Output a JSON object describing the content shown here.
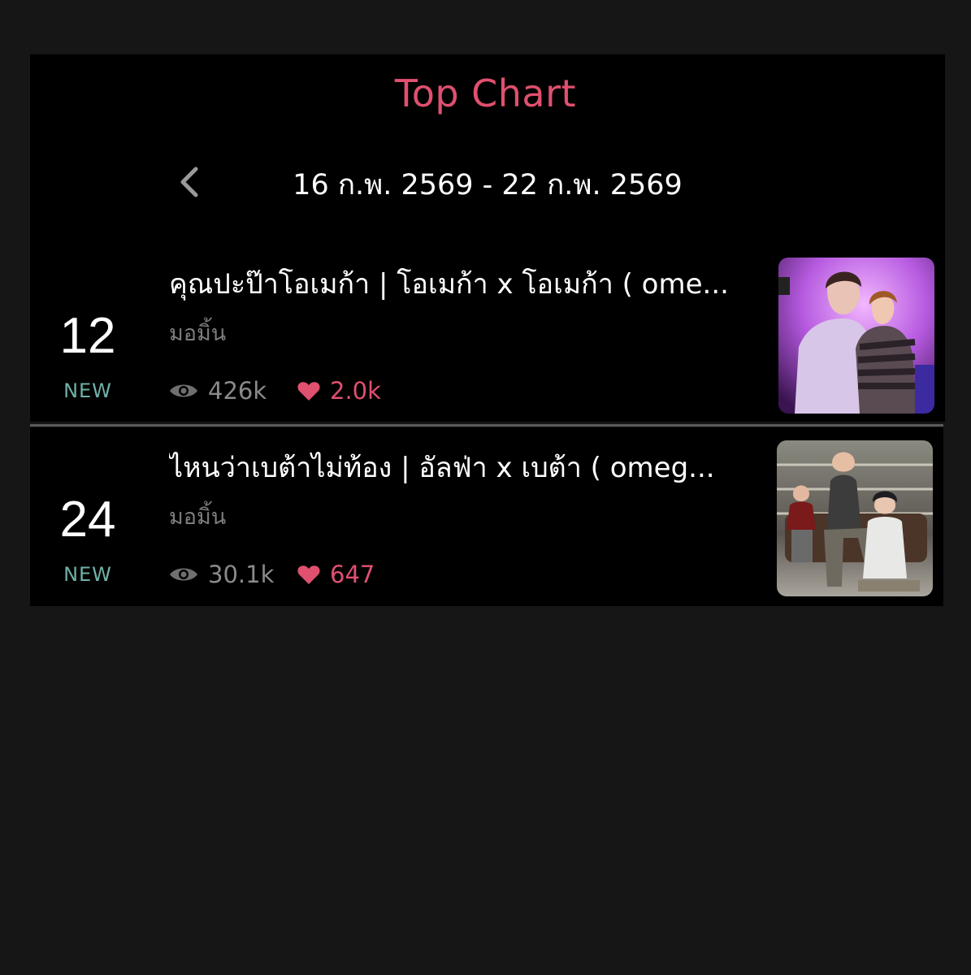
{
  "header": {
    "title": "Top Chart",
    "date_range": "16 ก.พ. 2569 - 22 ก.พ. 2569"
  },
  "colors": {
    "accent": "#e0506f",
    "new_badge": "#6fb1a8",
    "background": "#161616",
    "panel": "#000000"
  },
  "items": [
    {
      "rank": "12",
      "badge": "NEW",
      "title": "คุณปะป๊าโอเมก้า | โอเมก้า x โอเมก้า ( ome...",
      "author": "มอมิ้น",
      "views": "426k",
      "likes": "2.0k"
    },
    {
      "rank": "24",
      "badge": "NEW",
      "title": "ไหนว่าเบต้าไม่ท้อง | อัลฟ่า x เบต้า ( omeg...",
      "author": "มอมิ้น",
      "views": "30.1k",
      "likes": "647"
    }
  ],
  "icons": {
    "back": "chevron-left-icon",
    "views": "eye-icon",
    "likes": "heart-icon"
  }
}
